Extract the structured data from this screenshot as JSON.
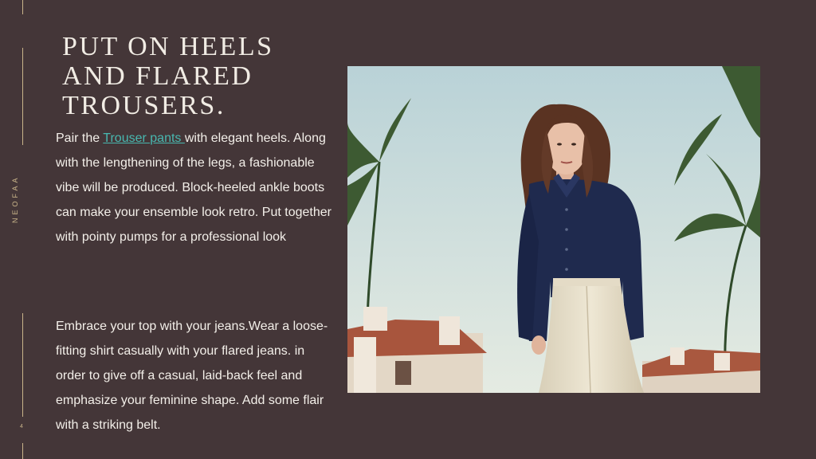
{
  "brand": "NEOFAA",
  "page_number": "4",
  "slide": {
    "title": "PUT ON HEELS AND FLARED TROUSERS.",
    "para1": {
      "prefix": "Pair the ",
      "link_text": "Trouser pants ",
      "suffix": "with elegant heels. Along with the lengthening of the legs, a fashionable vibe will be produced. Block-heeled ankle boots can make your ensemble look retro. Put together with pointy pumps for a professional look"
    },
    "para2": "Embrace your top with your jeans.Wear a loose-fitting shirt casually with your flared jeans. in order to give off a casual, laid-back feel and emphasize your feminine shape. Add some flair with a striking belt."
  },
  "colors": {
    "background": "#443638",
    "accent": "#c9b48a",
    "link": "#48b8b0",
    "text": "#f3efe9"
  },
  "icons": {
    "moon": "crescent-moon-icon"
  }
}
